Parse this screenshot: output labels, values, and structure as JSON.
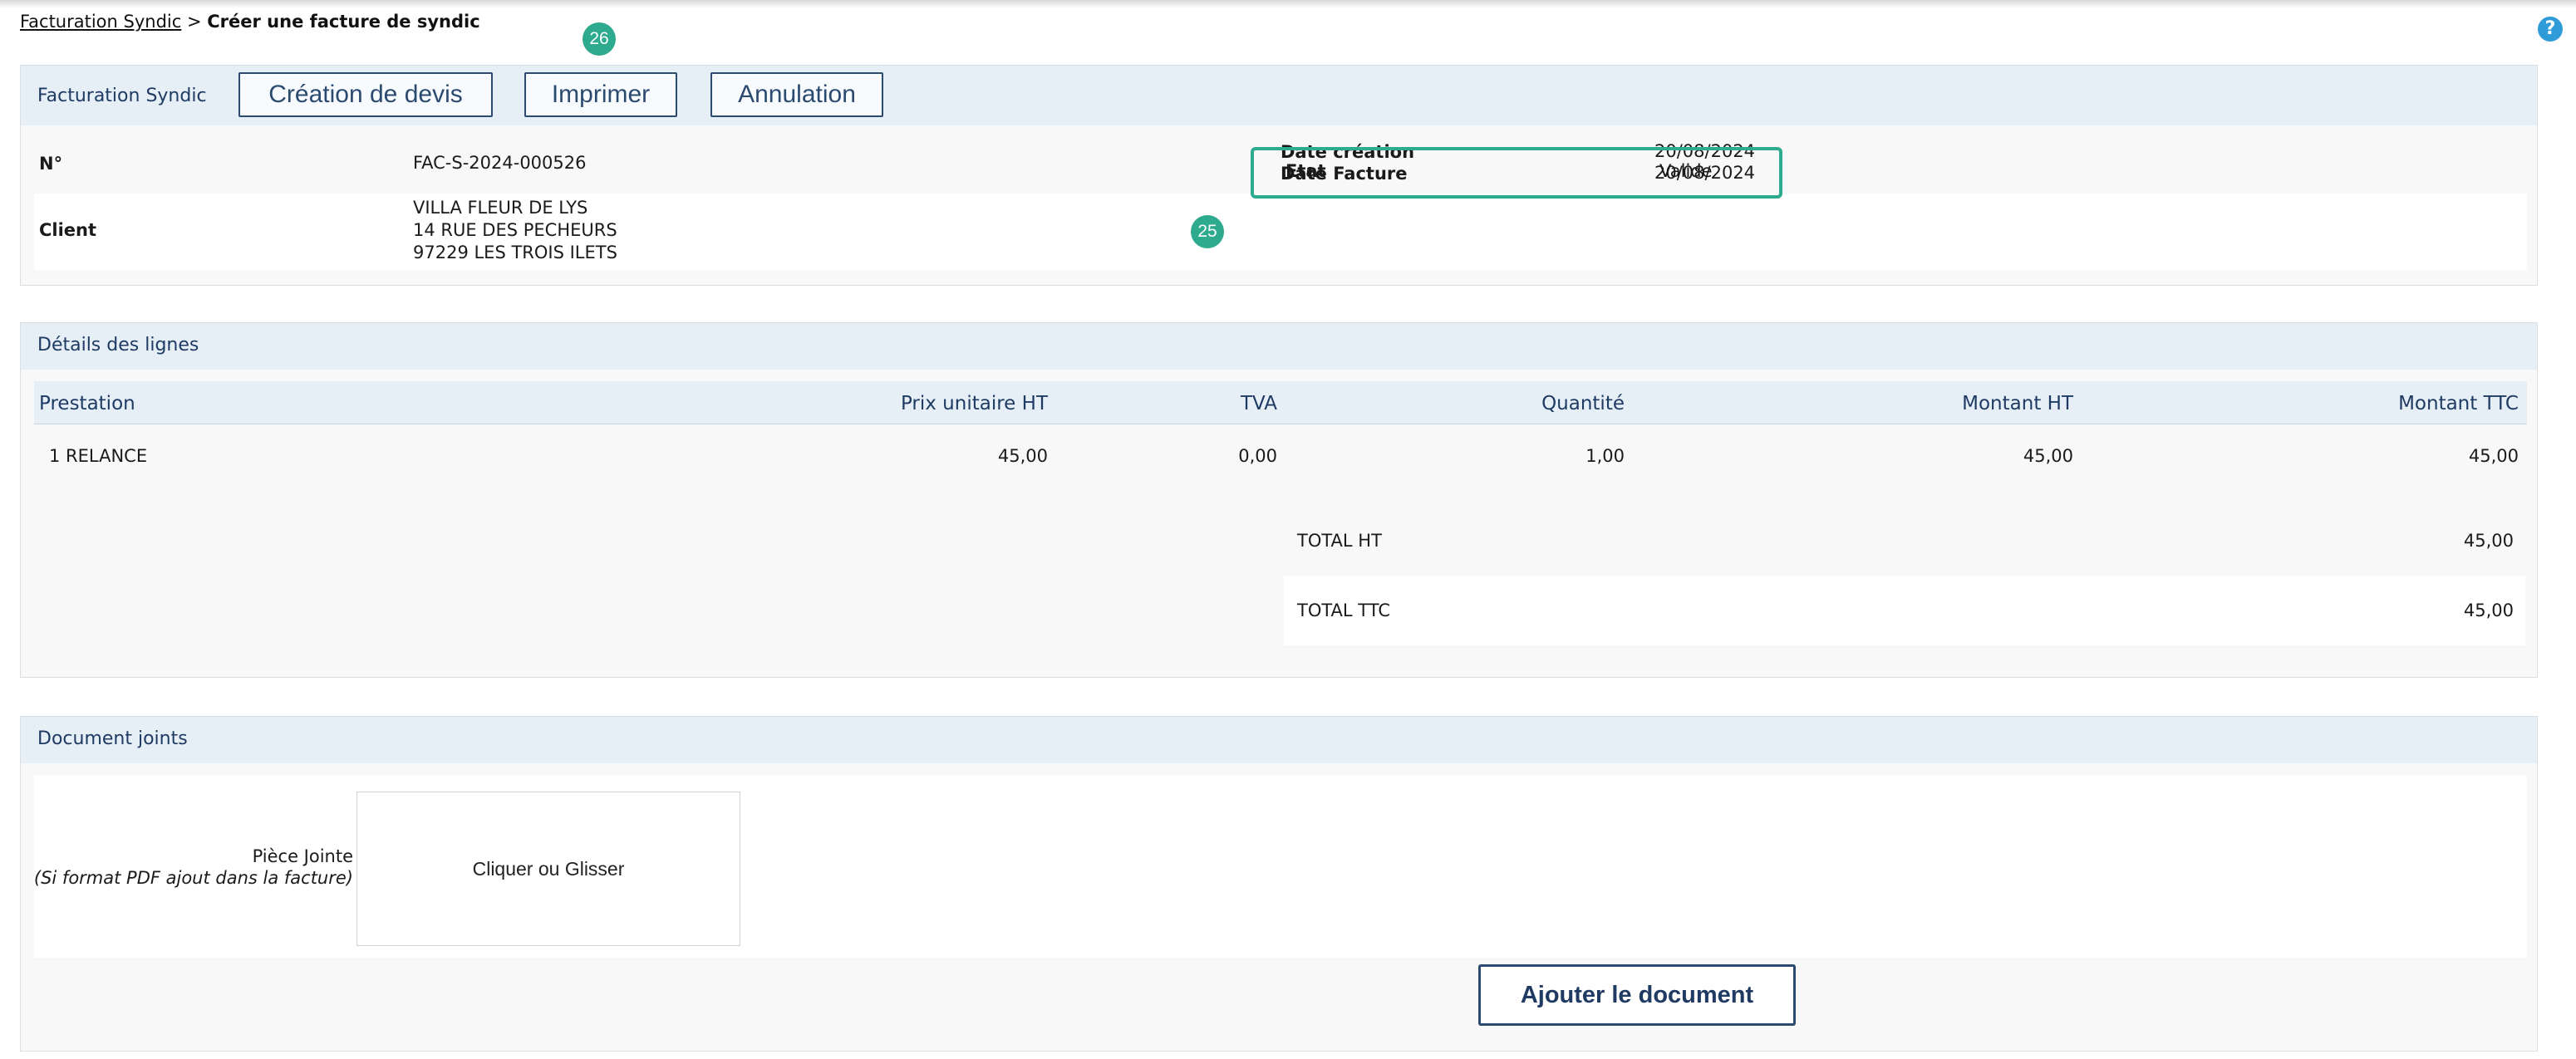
{
  "breadcrumb": {
    "link": "Facturation Syndic",
    "separator": " > ",
    "current": "Créer une facture de syndic"
  },
  "help_icon": "?",
  "markers": {
    "imprimer": "26",
    "etat": "25"
  },
  "facture_panel": {
    "title": "Facturation Syndic",
    "buttons": {
      "devis": "Création de devis",
      "imprimer": "Imprimer",
      "annulation": "Annulation"
    },
    "numero_label": "N°",
    "numero_value": "FAC-S-2024-000526",
    "date_creation_label": "Date création",
    "date_creation_value": "20/08/2024",
    "date_facture_label": "Date Facture",
    "date_facture_value": "20/08/2024",
    "client_label": "Client",
    "client_line1": "VILLA FLEUR DE LYS",
    "client_line2": "14 RUE DES PECHEURS",
    "client_line3": "97229 LES TROIS ILETS",
    "etat_label": "Etat",
    "etat_value": "Valide"
  },
  "lines_panel": {
    "title": "Détails des lignes",
    "headers": {
      "prestation": "Prestation",
      "prix": "Prix unitaire HT",
      "tva": "TVA",
      "quantite": "Quantité",
      "montant_ht": "Montant HT",
      "montant_ttc": "Montant TTC"
    },
    "rows": [
      {
        "prestation": "1 RELANCE",
        "prix": "45,00",
        "tva": "0,00",
        "quantite": "1,00",
        "montant_ht": "45,00",
        "montant_ttc": "45,00"
      }
    ],
    "total_ht_label": "TOTAL HT",
    "total_ht_value": "45,00",
    "total_ttc_label": "TOTAL TTC",
    "total_ttc_value": "45,00"
  },
  "docs_panel": {
    "title": "Document joints",
    "piece_label": "Pièce Jointe",
    "piece_hint": "(Si format PDF ajout dans la facture)",
    "dropzone_text": "Cliquer ou Glisser",
    "add_button": "Ajouter le document"
  },
  "colors": {
    "accent": "#2eaa8e",
    "header_bg": "#e6eef6",
    "button_border": "#2b4a6f",
    "help": "#2f9bd8"
  }
}
